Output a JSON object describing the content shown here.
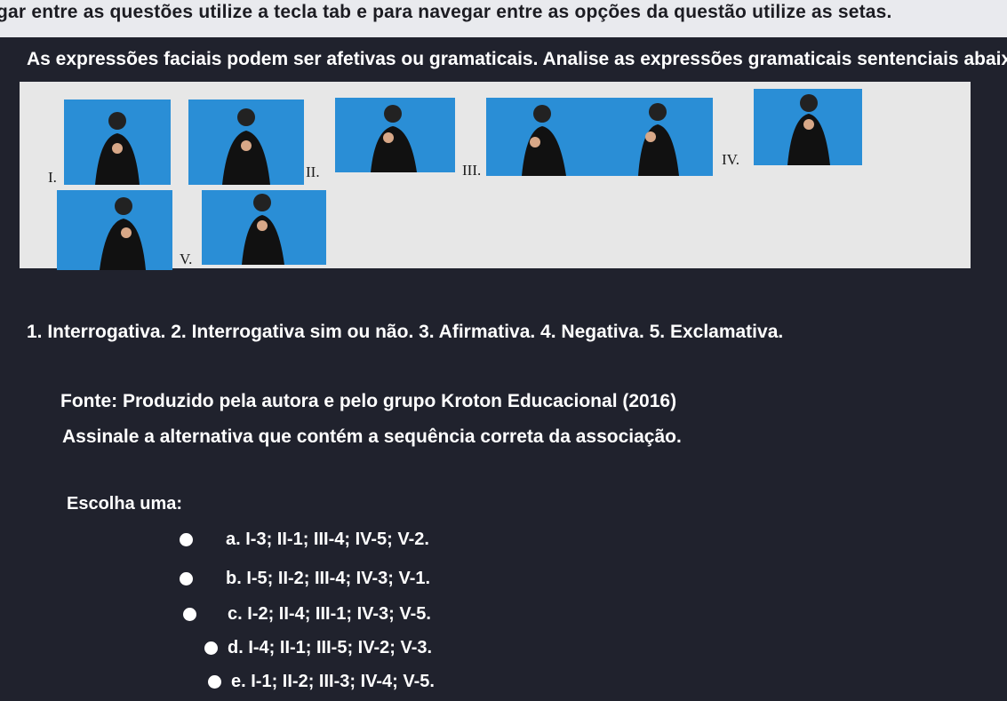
{
  "instruction_bar": "gar entre as questões utilize a tecla tab e para navegar entre as opções da questão utilize as setas.",
  "question": {
    "intro": "As expressões faciais podem ser afetivas ou gramaticais. Analise as expressões gramaticais sentenciais abaixo",
    "image_labels": [
      "I.",
      "II.",
      "III.",
      "IV.",
      "V."
    ],
    "types": "1. Interrogativa. 2. Interrogativa sim ou não. 3. Afirmativa. 4. Negativa. 5. Exclamativa.",
    "source": "Fonte: Produzido pela autora e pelo grupo Kroton Educacional (2016)",
    "prompt": "Assinale a alternativa que contém a sequência correta da associação."
  },
  "choose_label": "Escolha uma:",
  "options": [
    {
      "label": "a. I-3; II-1; III-4; IV-5; V-2."
    },
    {
      "label": "b. I-5; II-2; III-4; IV-3; V-1."
    },
    {
      "label": "c. I-2; II-4; III-1; IV-3; V-5."
    },
    {
      "label": "d. I-4; II-1; III-5; IV-2; V-3."
    },
    {
      "label": "e. I-1; II-2; III-3; IV-4; V-5."
    }
  ],
  "colors": {
    "background": "#20222d",
    "photo_bg": "#2a8ed6",
    "topbar": "#e9eaee"
  }
}
